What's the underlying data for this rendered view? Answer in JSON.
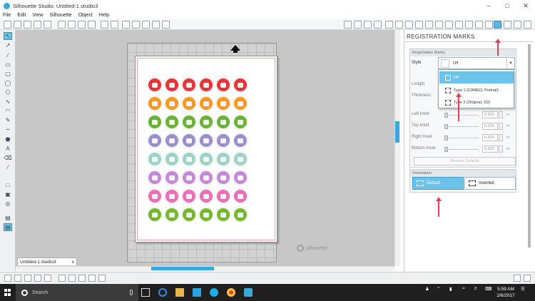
{
  "window": {
    "title": "Silhouette Studio: Untitled-1.studio3"
  },
  "menu": [
    "File",
    "Edit",
    "View",
    "Silhouette",
    "Object",
    "Help"
  ],
  "document_tab": {
    "label": "Untitled-1.studio3",
    "close": "x"
  },
  "canvas": {
    "brand_watermark": "silhouette"
  },
  "panel": {
    "title": "REGISTRATION MARKS",
    "reg_section_header": "Registration Marks",
    "style_label": "Style",
    "style_value": "Off",
    "dropdown_options": [
      "Off",
      "Type 1 (CAMEO, Portrait)",
      "Type 2 (Original, SD)"
    ],
    "length_label": "Length",
    "thickness_label": "Thickness",
    "left_inset_label": "Left Inset",
    "top_inset_label": "Top Inset",
    "right_inset_label": "Right Inset",
    "bottom_inset_label": "Bottom Inset",
    "inset_values": [
      "0.625",
      "0.625",
      "0.625",
      "0.625"
    ],
    "unit": "in",
    "restore_label": "Restore Defaults",
    "orientation_header": "Orientation",
    "orientation_default": "Default",
    "orientation_inverted": "Inverted"
  },
  "taskbar": {
    "search_placeholder": "Search",
    "time": "5:59 AM",
    "date": "2/6/2017"
  },
  "colors": {
    "accent": "#39a9dc",
    "selected": "#6cc3ea",
    "annotation_arrow": "#e0404f",
    "circle_rows": [
      "#ea3238",
      "#f39a1f",
      "#69b233",
      "#9b8fd0",
      "#9cd3c6",
      "#c58ad6",
      "#f06cb6",
      "#74b82d"
    ]
  }
}
